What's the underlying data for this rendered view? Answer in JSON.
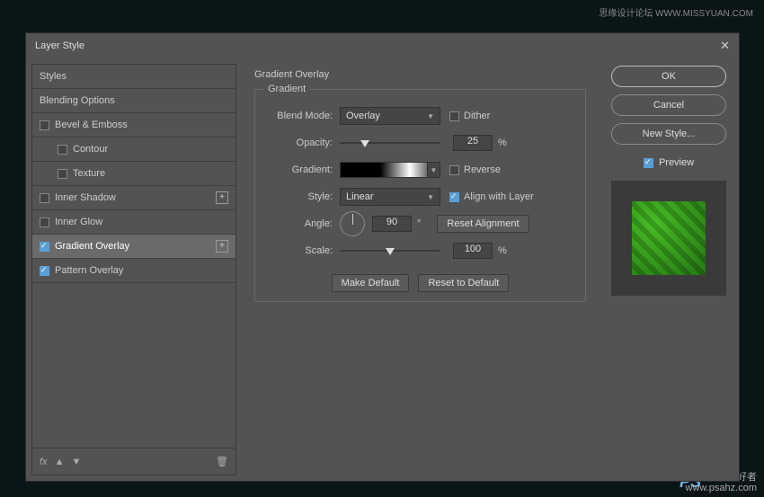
{
  "watermark": {
    "top": "思缘设计论坛  WWW.MISSYUAN.COM",
    "ps": "PS",
    "bottom": "爱好者\nwww.psahz.com"
  },
  "dialog": {
    "title": "Layer Style"
  },
  "styles_panel": {
    "header": "Styles",
    "blending": "Blending Options",
    "bevel": "Bevel & Emboss",
    "contour": "Contour",
    "texture": "Texture",
    "inner_shadow": "Inner Shadow",
    "inner_glow": "Inner Glow",
    "gradient_overlay": "Gradient Overlay",
    "pattern_overlay": "Pattern Overlay",
    "fx": "fx"
  },
  "gradient": {
    "section": "Gradient Overlay",
    "legend": "Gradient",
    "blend_mode_label": "Blend Mode:",
    "blend_mode_value": "Overlay",
    "dither": "Dither",
    "opacity_label": "Opacity:",
    "opacity_value": "25",
    "percent": "%",
    "gradient_label": "Gradient:",
    "reverse": "Reverse",
    "style_label": "Style:",
    "style_value": "Linear",
    "align": "Align with Layer",
    "angle_label": "Angle:",
    "angle_value": "90",
    "degree": "°",
    "reset_alignment": "Reset Alignment",
    "scale_label": "Scale:",
    "scale_value": "100",
    "make_default": "Make Default",
    "reset_default": "Reset to Default"
  },
  "right": {
    "ok": "OK",
    "cancel": "Cancel",
    "new_style": "New Style...",
    "preview": "Preview"
  }
}
